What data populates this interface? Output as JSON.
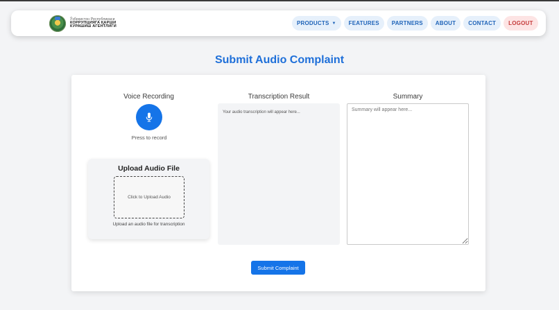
{
  "brand": {
    "line1": "Ўзбекистон Республикаси",
    "line2": "КОРРУПЦИЯГА ҚАРШИ",
    "line3": "КУРАШИШ АГЕНТЛИГИ"
  },
  "nav": {
    "products": "PRODUCTS",
    "features": "FEATURES",
    "partners": "PARTNERS",
    "about": "ABOUT",
    "contact": "CONTACT",
    "logout": "LOGOUT"
  },
  "page": {
    "title": "Submit Audio Complaint"
  },
  "voice": {
    "heading": "Voice Recording",
    "press_text": "Press to record"
  },
  "upload": {
    "title": "Upload Audio File",
    "dropzone_text": "Click to Upload Audio",
    "help_text": "Upload an audio file for transcription"
  },
  "transcription": {
    "heading": "Transcription Result",
    "placeholder": "Your audio transcription will appear here..."
  },
  "summary": {
    "heading": "Summary",
    "placeholder": "Summary will appear here..."
  },
  "submit": {
    "label": "Submit Complaint"
  },
  "colors": {
    "primary": "#1574e8",
    "title": "#1e6fd9",
    "nav_pill_bg": "#e6f0fb",
    "nav_pill_text": "#1e63b8",
    "logout_bg": "#fde4e4",
    "logout_text": "#c53a3a"
  },
  "icons": {
    "mic": "microphone-icon",
    "caret": "chevron-down-icon",
    "logo": "state-emblem-icon"
  }
}
